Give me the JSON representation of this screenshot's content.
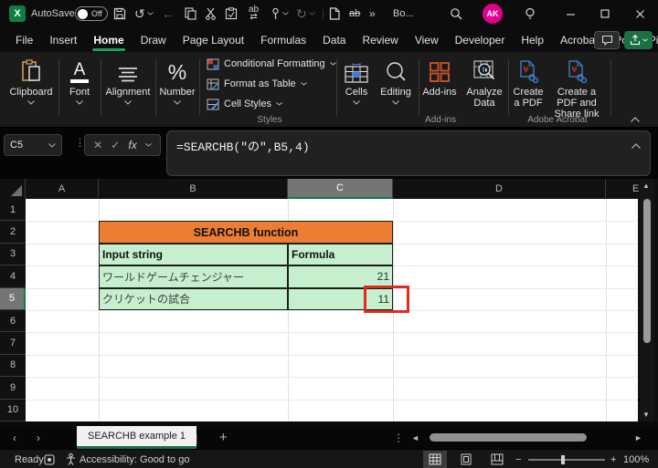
{
  "titlebar": {
    "app_initial": "X",
    "autosave_label": "AutoSave",
    "autosave_state": "Off",
    "more_commands": "»",
    "workbook_name": "Bo...",
    "avatar_initials": "AK"
  },
  "ribbon": {
    "tabs": [
      {
        "label": "File"
      },
      {
        "label": "Insert"
      },
      {
        "label": "Home"
      },
      {
        "label": "Draw"
      },
      {
        "label": "Page Layout"
      },
      {
        "label": "Formulas"
      },
      {
        "label": "Data"
      },
      {
        "label": "Review"
      },
      {
        "label": "View"
      },
      {
        "label": "Developer"
      },
      {
        "label": "Help"
      },
      {
        "label": "Acrobat"
      },
      {
        "label": "Power Pivot"
      }
    ],
    "active_tab": "Home",
    "groups": {
      "clipboard": "Clipboard",
      "font": "Font",
      "alignment": "Alignment",
      "number": "Number",
      "styles_items": [
        "Conditional Formatting",
        "Format as Table",
        "Cell Styles"
      ],
      "styles_label": "Styles",
      "cells": "Cells",
      "editing": "Editing",
      "addins_button": "Add-ins",
      "addins_label": "Add-ins",
      "analyze": "Analyze Data",
      "pdf_create": "Create a PDF",
      "pdf_share": "Create a PDF and Share link",
      "acrobat_label": "Adobe Acrobat"
    }
  },
  "formula_bar": {
    "name_box": "C5",
    "fx": "fx",
    "formula": "=SEARCHB(\"の\",B5,4)"
  },
  "grid": {
    "columns": [
      "A",
      "B",
      "C",
      "D"
    ],
    "partial_column": "E",
    "selected_column": "C",
    "rows": [
      "1",
      "2",
      "3",
      "4",
      "5",
      "6",
      "7",
      "8",
      "9",
      "10"
    ],
    "selected_row": "5",
    "selected_cell": "C5",
    "table": {
      "title": "SEARCHB function",
      "col_input": "Input string",
      "col_formula": "Formula",
      "rows": [
        {
          "input": "ワールドゲームチェンジャー",
          "value": "21"
        },
        {
          "input": "クリケットの試合",
          "value": "11"
        }
      ]
    },
    "colors": {
      "title_fill": "#ED7D31",
      "cell_fill": "#C6EFCE",
      "annotation_red": "#E02B20",
      "accent_green": "#107C41"
    }
  },
  "sheet_bar": {
    "active_tab": "SEARCHB example 1",
    "add_sheet": "+"
  },
  "status_bar": {
    "ready": "Ready",
    "accessibility": "Accessibility: Good to go",
    "zoom_level": "100%"
  }
}
